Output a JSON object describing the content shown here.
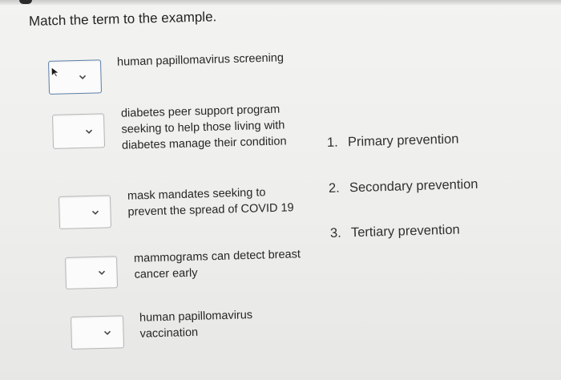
{
  "question": "Match the term to the example.",
  "items": [
    {
      "text": "human papillomavirus screening",
      "lines": [
        "human papillomavirus screening"
      ]
    },
    {
      "text": "diabetes peer support program seeking to help those living with diabetes manage their condition",
      "lines": [
        "diabetes peer support program",
        "seeking to help those living with",
        "diabetes manage their condition"
      ]
    },
    {
      "text": "mask mandates seeking to prevent the spread of COVID 19",
      "lines": [
        "mask mandates seeking to",
        "prevent the spread of COVID 19"
      ]
    },
    {
      "text": "mammograms can detect breast cancer early",
      "lines": [
        "mammograms can detect breast",
        "cancer early"
      ]
    },
    {
      "text": "human papillomavirus vaccination",
      "lines": [
        "human papillomavirus",
        "vaccination"
      ]
    }
  ],
  "options": [
    {
      "number": "1.",
      "label": "Primary prevention"
    },
    {
      "number": "2.",
      "label": "Secondary prevention"
    },
    {
      "number": "3.",
      "label": "Tertiary prevention"
    }
  ]
}
